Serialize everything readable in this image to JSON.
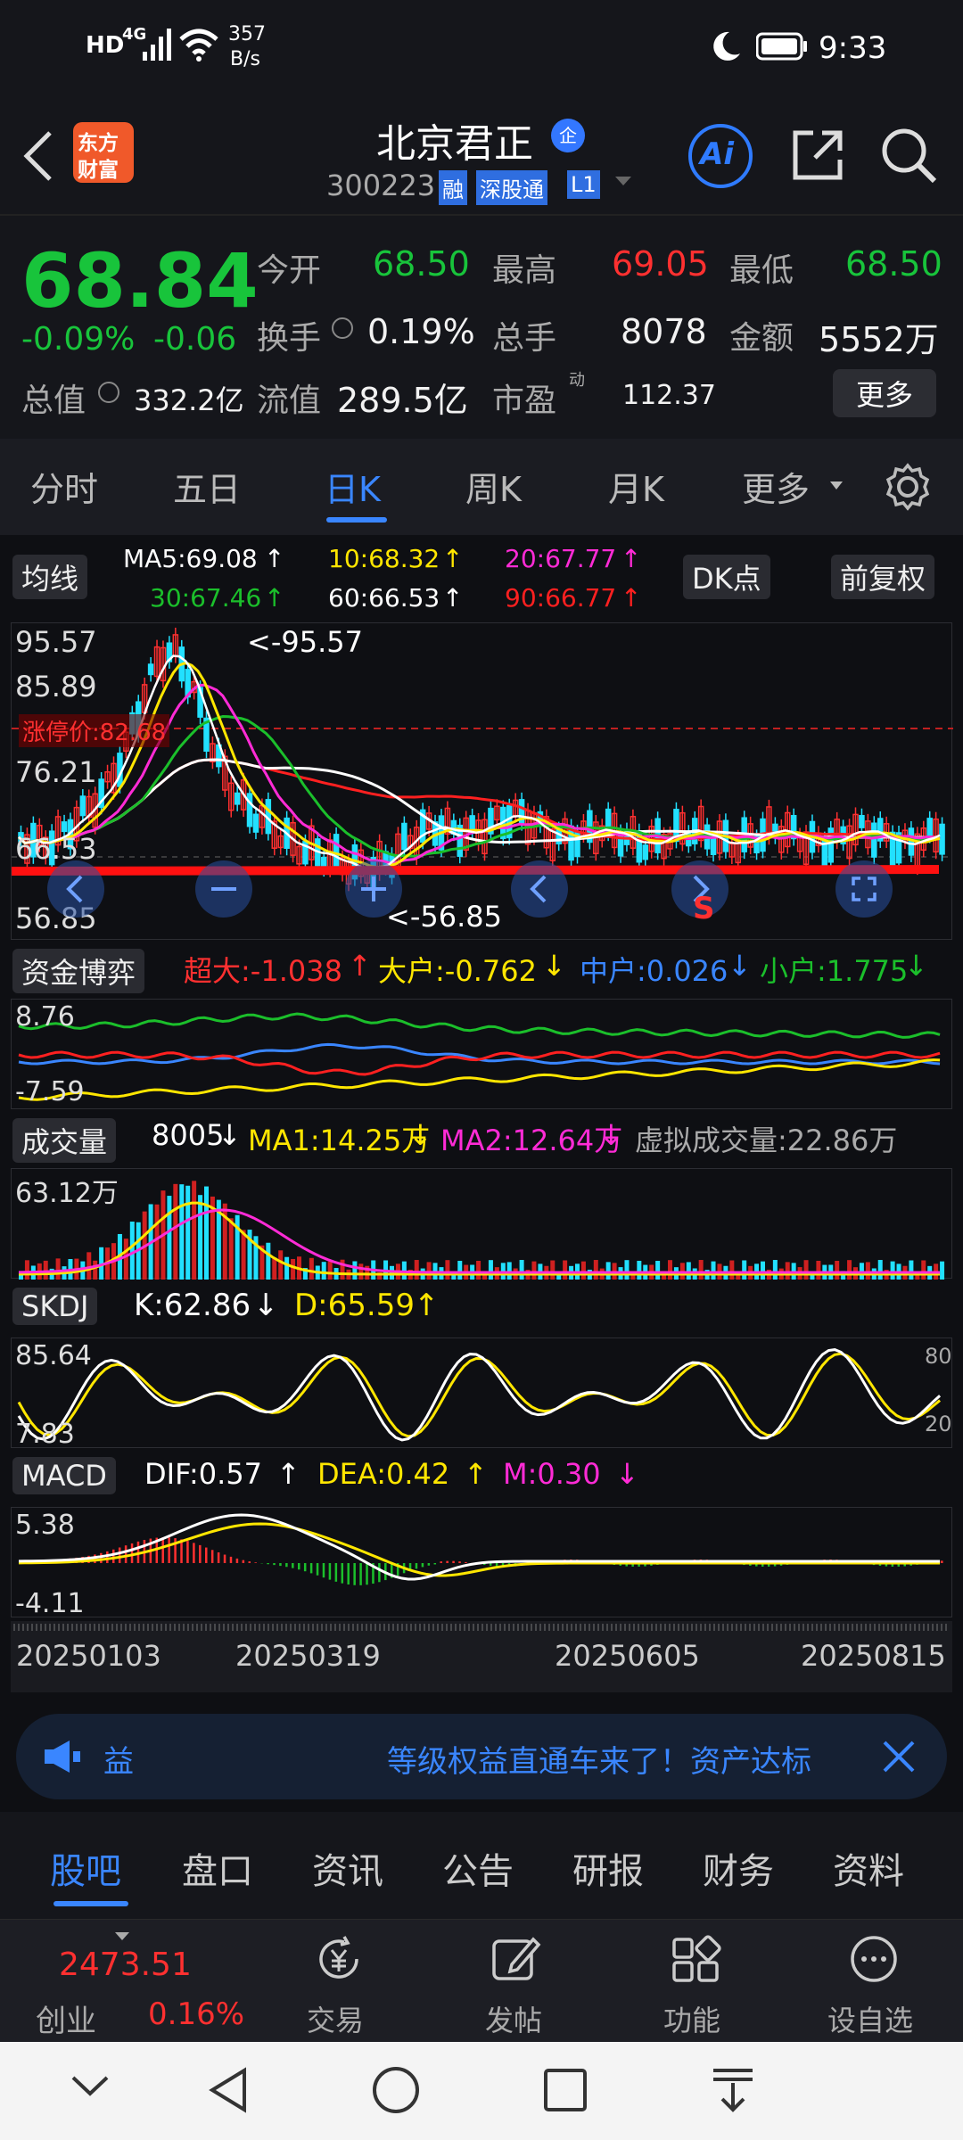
{
  "status": {
    "net1": "HD",
    "net2": "4G",
    "speed": "357",
    "speed_unit": "B/s",
    "time": "9:33"
  },
  "header": {
    "logo_line1": "东方",
    "logo_line2": "财富",
    "title": "北京君正",
    "badge": "企",
    "code": "300223",
    "tag_margin": "融",
    "tag_connect": "深股通",
    "tag_level": "L1",
    "ai": "Ai"
  },
  "quote": {
    "price": "68.84",
    "change_pct": "-0.09%",
    "change": "-0.06",
    "total_value_label": "总值",
    "total_value": "332.2亿",
    "open_label": "今开",
    "open": "68.50",
    "high_label": "最高",
    "high": "69.05",
    "low_label": "最低",
    "low": "68.50",
    "turnover_label": "换手",
    "turnover": "0.19%",
    "volume_label": "总手",
    "volume": "8078",
    "amount_label": "金额",
    "amount": "5552万",
    "float_label": "流值",
    "float": "289.5亿",
    "pe_label": "市盈",
    "pe_sup": "动",
    "pe": "112.37",
    "more": "更多"
  },
  "tabs": [
    "分时",
    "五日",
    "日K",
    "周K",
    "月K",
    "更多"
  ],
  "active_tab": 2,
  "ma": {
    "label": "均线",
    "ma5": "MA5:69.08",
    "ma10": "10:68.32",
    "ma20": "20:67.77",
    "ma30": "30:67.46",
    "ma60": "60:66.53",
    "ma90": "90:66.77",
    "dk": "DK点",
    "fq": "前复权"
  },
  "kline": {
    "y_top": "95.57",
    "y_2": "85.89",
    "limit": "涨停价:82.68",
    "y_3": "76.21",
    "y_4": "66.53",
    "y_bottom": "56.85",
    "max_tag": "<-95.57",
    "min_tag": "<-56.85",
    "sell_mark": "S"
  },
  "fund": {
    "label": "资金博弈",
    "super": "超大:-1.038",
    "big": "大户:-0.762",
    "mid": "中户:0.026",
    "small": "小户:1.775",
    "y_top": "8.76",
    "y_bottom": "-7.59"
  },
  "volume": {
    "label": "成交量",
    "vol": "8005",
    "ma1": "MA1:14.25万",
    "ma2": "MA2:12.64万",
    "virtual": "虚拟成交量:22.86万",
    "y_top": "63.12万"
  },
  "skdj": {
    "label": "SKDJ",
    "k": "K:62.86",
    "d": "D:65.59",
    "y_top": "85.64",
    "y_bottom": "7.83",
    "r80": "80",
    "r20": "20"
  },
  "macd": {
    "label": "MACD",
    "dif": "DIF:0.57",
    "dea": "DEA:0.42",
    "m": "M:0.30",
    "y_top": "5.38",
    "y_bottom": "-4.11"
  },
  "dates": [
    "20250103",
    "20250319",
    "20250605",
    "20250815"
  ],
  "banner": {
    "prefix": "益",
    "text": "等级权益直通车来了！资产达标"
  },
  "bottom_tabs": [
    "股吧",
    "盘口",
    "资讯",
    "公告",
    "研报",
    "财务",
    "资料"
  ],
  "toolbar": {
    "index_value": "2473.51",
    "index_name": "创业",
    "index_change": "0.16%",
    "trade": "交易",
    "post": "发帖",
    "func": "功能",
    "watch": "设自选"
  },
  "colors": {
    "up": "#ff3030",
    "down": "#18c43b",
    "accent": "#2f7bff",
    "ma5": "#ffffff",
    "ma10": "#ffe600",
    "ma20": "#ff2bd6",
    "ma30": "#1bbf2b",
    "ma60": "#ffffff",
    "ma90": "#ff2020"
  }
}
